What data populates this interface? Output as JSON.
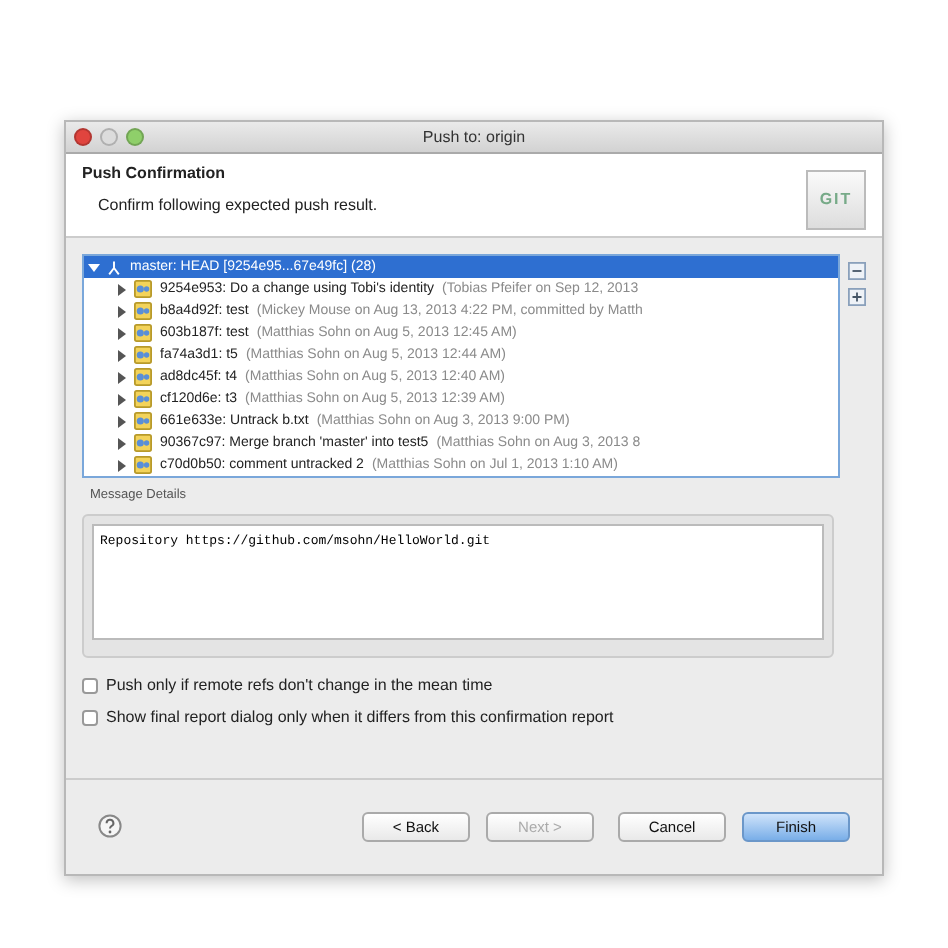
{
  "window": {
    "title": "Push to: origin"
  },
  "header": {
    "title": "Push Confirmation",
    "subtitle": "Confirm following expected push result.",
    "logo": "GIT"
  },
  "tree": {
    "label": "master: HEAD [9254e95...67e49fc] (28)",
    "expanded": true,
    "selected": true,
    "children": [
      {
        "summary": "9254e953: Do a change using Tobi's identity",
        "detail": "(Tobias Pfeifer on Sep 12, 2013",
        "expanded": false
      },
      {
        "summary": "b8a4d92f: test",
        "detail": "(Mickey Mouse on Aug 13, 2013 4:22 PM, committed by Matth",
        "expanded": false
      },
      {
        "summary": "603b187f: test",
        "detail": "(Matthias Sohn on Aug 5, 2013 12:45 AM)",
        "expanded": false
      },
      {
        "summary": "fa74a3d1: t5",
        "detail": "(Matthias Sohn on Aug 5, 2013 12:44 AM)",
        "expanded": false
      },
      {
        "summary": "ad8dc45f: t4",
        "detail": "(Matthias Sohn on Aug 5, 2013 12:40 AM)",
        "expanded": false
      },
      {
        "summary": "cf120d6e: t3",
        "detail": "(Matthias Sohn on Aug 5, 2013 12:39 AM)",
        "expanded": false
      },
      {
        "summary": "661e633e: Untrack b.txt",
        "detail": "(Matthias Sohn on Aug 3, 2013 9:00 PM)",
        "expanded": false
      },
      {
        "summary": "90367c97: Merge branch 'master' into test5",
        "detail": "(Matthias Sohn on Aug 3, 2013 8",
        "expanded": false
      },
      {
        "summary": "c70d0b50: comment untracked 2",
        "detail": "(Matthias Sohn on Jul 1, 2013 1:10 AM)",
        "expanded": false
      }
    ]
  },
  "message_details": {
    "label": "Message Details",
    "value": "Repository https://github.com/msohn/HelloWorld.git"
  },
  "options": [
    {
      "label": "Push only if remote refs don't change in the mean time",
      "checked": false
    },
    {
      "label": "Show final report dialog only when it differs from this confirmation report",
      "checked": false
    }
  ],
  "buttons": [
    {
      "label": "< Back",
      "disabled": false,
      "default": false
    },
    {
      "label": "Next >",
      "disabled": true,
      "default": false
    },
    {
      "label": "Cancel",
      "disabled": false,
      "default": false
    },
    {
      "label": "Finish",
      "disabled": false,
      "default": true
    }
  ]
}
